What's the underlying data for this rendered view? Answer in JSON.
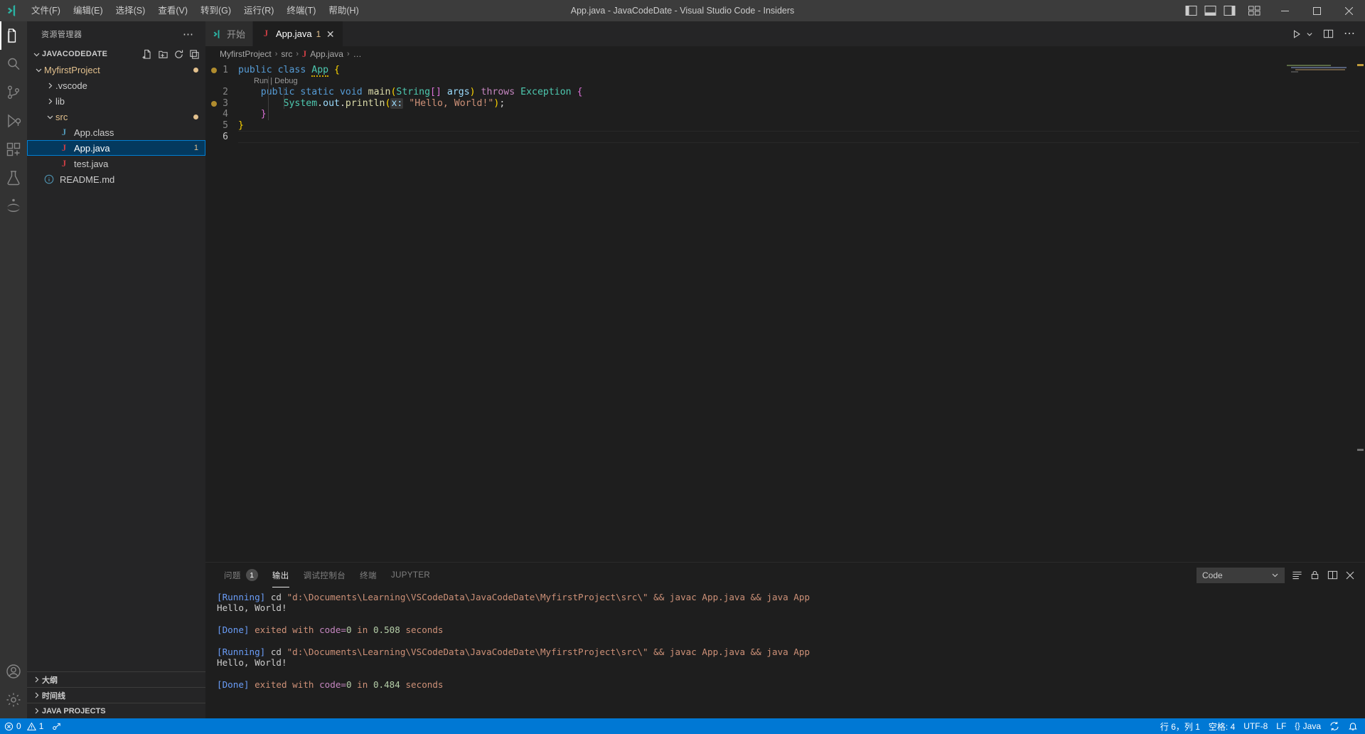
{
  "titlebar": {
    "title": "App.java - JavaCodeDate - Visual Studio Code - Insiders",
    "menus": [
      "文件(F)",
      "编辑(E)",
      "选择(S)",
      "查看(V)",
      "转到(G)",
      "运行(R)",
      "终端(T)",
      "帮助(H)"
    ],
    "window_controls": {
      "minimize": "─",
      "maximize": "☐",
      "close": "✕"
    }
  },
  "activitybar": {
    "items": [
      {
        "name": "explorer",
        "icon": "files-icon"
      },
      {
        "name": "search",
        "icon": "search-icon"
      },
      {
        "name": "source-control",
        "icon": "source-control-icon"
      },
      {
        "name": "run-debug",
        "icon": "run-debug-icon"
      },
      {
        "name": "extensions",
        "icon": "extensions-icon"
      },
      {
        "name": "testing",
        "icon": "beaker-icon"
      },
      {
        "name": "jupyter",
        "icon": "jupyter-icon"
      }
    ],
    "bottom": [
      {
        "name": "accounts",
        "icon": "account-icon"
      },
      {
        "name": "manage",
        "icon": "gear-icon"
      }
    ]
  },
  "sidebar": {
    "title": "资源管理器",
    "more_label": "⋯",
    "root": {
      "label": "JAVACODEDATE",
      "actions": [
        "new-file-icon",
        "new-folder-icon",
        "refresh-icon",
        "collapse-all-icon"
      ]
    },
    "tree": [
      {
        "label": "MyfirstProject",
        "kind": "folder",
        "depth": 1,
        "expanded": true,
        "badge_dot": true
      },
      {
        "label": ".vscode",
        "kind": "folder",
        "depth": 2,
        "expanded": false
      },
      {
        "label": "lib",
        "kind": "folder",
        "depth": 2,
        "expanded": false
      },
      {
        "label": "src",
        "kind": "folder",
        "depth": 2,
        "expanded": true,
        "badge_dot": true
      },
      {
        "label": "App.class",
        "kind": "java-class",
        "depth": 3
      },
      {
        "label": "App.java",
        "kind": "java",
        "depth": 3,
        "selected": true,
        "badge_num": "1"
      },
      {
        "label": "test.java",
        "kind": "java",
        "depth": 3
      },
      {
        "label": "README.md",
        "kind": "markdown",
        "depth": 2
      }
    ],
    "bottom_sections": [
      "大纲",
      "时间线",
      "JAVA PROJECTS"
    ]
  },
  "editor": {
    "tabs": [
      {
        "label": "开始",
        "icon": "vscode-icon",
        "active": false,
        "closable": false
      },
      {
        "label": "App.java",
        "icon": "java-icon",
        "active": true,
        "dirty_count": "1",
        "close": "✕"
      }
    ],
    "actions": [
      "run-play-icon",
      "chevron-down-icon",
      "split-editor-icon",
      "more-actions-icon"
    ],
    "breadcrumb": [
      "MyfirstProject",
      "src",
      "App.java",
      "…"
    ],
    "breadcrumb_separator": "›",
    "codelens": {
      "run": "Run",
      "sep": "|",
      "debug": "Debug"
    },
    "lines": [
      {
        "num": "1",
        "text": "public class App {"
      },
      {
        "num": "2",
        "text": "    public static void main(String[] args) throws Exception {"
      },
      {
        "num": "3",
        "text": "        System.out.println(x: \"Hello, World!\");"
      },
      {
        "num": "4",
        "text": "    }"
      },
      {
        "num": "5",
        "text": "}"
      },
      {
        "num": "6",
        "text": ""
      }
    ],
    "param_hint": "x:"
  },
  "panel": {
    "tabs": [
      {
        "label": "问题",
        "badge": "1",
        "active": false
      },
      {
        "label": "输出",
        "active": true
      },
      {
        "label": "调试控制台",
        "active": false
      },
      {
        "label": "终端",
        "active": false
      },
      {
        "label": "JUPYTER",
        "active": false
      }
    ],
    "channel": {
      "value": "Code",
      "chevron": "⌄"
    },
    "actions": [
      "clear-output-icon",
      "lock-icon",
      "split-panel-icon",
      "close-panel-icon"
    ],
    "output": [
      {
        "type": "running",
        "tag": "[Running]",
        "cmd_pre": " cd ",
        "path": "\"d:\\Documents\\Learning\\VSCodeData\\JavaCodeDate\\MyfirstProject\\src\\\"",
        "cmd_post": " && javac App.java && java App"
      },
      {
        "type": "plain",
        "text": "Hello, World!"
      },
      {
        "type": "blank",
        "text": ""
      },
      {
        "type": "done",
        "tag": "[Done]",
        "mid": " exited with ",
        "code_kw": "code=",
        "code_val": "0",
        "tail_pre": " in ",
        "seconds": "0.508",
        "tail": " seconds"
      },
      {
        "type": "blank",
        "text": ""
      },
      {
        "type": "running",
        "tag": "[Running]",
        "cmd_pre": " cd ",
        "path": "\"d:\\Documents\\Learning\\VSCodeData\\JavaCodeDate\\MyfirstProject\\src\\\"",
        "cmd_post": " && javac App.java && java App"
      },
      {
        "type": "plain",
        "text": "Hello, World!"
      },
      {
        "type": "blank",
        "text": ""
      },
      {
        "type": "done",
        "tag": "[Done]",
        "mid": " exited with ",
        "code_kw": "code=",
        "code_val": "0",
        "tail_pre": " in ",
        "seconds": "0.484",
        "tail": " seconds"
      }
    ]
  },
  "statusbar": {
    "errors": "0",
    "warnings": "1",
    "ports_icon": "remote-ports-icon",
    "position": "行 6，列 1",
    "indent": "空格: 4",
    "encoding": "UTF-8",
    "eol": "LF",
    "language": "Java",
    "sync_icon": "sync-icon",
    "bell_icon": "bell-icon",
    "brackets_icon": "brackets-icon"
  },
  "colors": {
    "accent": "#0078d4",
    "selection": "#04395e",
    "folder": "#e2c08d",
    "titlebar_bg": "#3c3c3c",
    "sidebar_bg": "#252526",
    "editor_bg": "#1e1e1e",
    "activitybar_bg": "#333333"
  }
}
